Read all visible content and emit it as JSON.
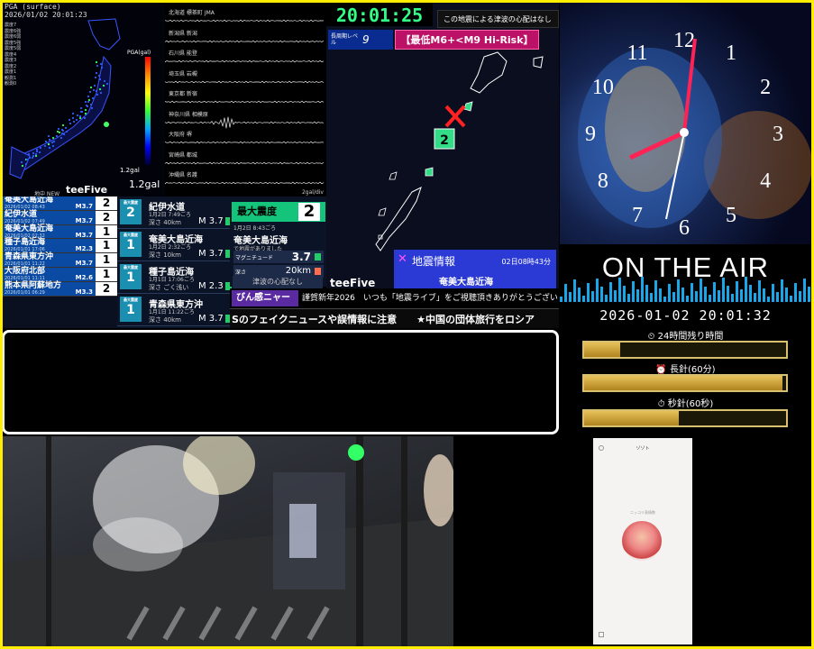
{
  "left_map": {
    "header_line1": "PGA (surface)",
    "header_line2": "2026/01/02 20:01:23",
    "legend_lines": [
      "震度7",
      "震度6強",
      "震度6弱",
      "震度5強",
      "震度5弱",
      "震度4",
      "震度3",
      "震度2",
      "震度1",
      "観測1",
      "観測0"
    ],
    "pga_label": "PGA(gal)",
    "scale_value": "1.2gal",
    "scale_small": "1.2gal",
    "footer_left": "地中 NEW",
    "brand": "teeFive"
  },
  "seismo": {
    "stations": [
      "北海道 標茶町 JMA",
      "新潟県 新潟",
      "石川県 能登",
      "埼玉県 岩槻",
      "東京都 新宿",
      "神奈川県 相模原",
      "大阪府 堺",
      "宮崎県 都城",
      "沖縄県 名護"
    ],
    "footer": "2gal/div"
  },
  "intensity_list": [
    {
      "name": "奄美大島近海",
      "date": "2026/01/02 08:43",
      "mag": "M3.7",
      "val": "2"
    },
    {
      "name": "紀伊水道",
      "date": "2026/01/02 07:49",
      "mag": "M3.7",
      "val": "2"
    },
    {
      "name": "奄美大島近海",
      "date": "2026/01/02 02:32",
      "mag": "M3.7",
      "val": "1"
    },
    {
      "name": "種子島近海",
      "date": "2026/01/01 17:06",
      "mag": "M2.3",
      "val": "1"
    },
    {
      "name": "青森県東方沖",
      "date": "2026/01/01 11:22",
      "mag": "M3.7",
      "val": "1"
    },
    {
      "name": "大阪府北部",
      "date": "2026/01/01 11:11",
      "mag": "M2.6",
      "val": "1"
    },
    {
      "name": "熊本県阿蘇地方",
      "date": "2026/01/01 06:29",
      "mag": "M3.3",
      "val": "2"
    }
  ],
  "quake_list": [
    {
      "badge_label": "最大震度",
      "val": "2",
      "name": "紀伊水道",
      "date": "1月2日 7:49ごろ",
      "depth": "深さ 40km",
      "mag": "M 3.7"
    },
    {
      "badge_label": "最大震度",
      "val": "1",
      "name": "奄美大島近海",
      "date": "1月2日 2:32ごろ",
      "depth": "深さ 10km",
      "mag": "M 3.7"
    },
    {
      "badge_label": "最大震度",
      "val": "1",
      "name": "種子島近海",
      "date": "1月1日 17:06ごろ",
      "depth": "深さ ごく浅い",
      "mag": "M 2.3"
    },
    {
      "badge_label": "最大震度",
      "val": "1",
      "name": "青森県東方沖",
      "date": "1月1日 11:22ごろ",
      "depth": "深さ 40km",
      "mag": "M 3.7"
    }
  ],
  "max_intensity": {
    "label": "最大震度",
    "value": "2",
    "time": "1月2日 8:43ごろ",
    "region": "奄美大島近海",
    "region_note": "で地震がありました",
    "mag_label": "マグニチュード",
    "mag_value": "3.7",
    "depth_label": "深さ",
    "depth_value": "20km",
    "tsunami": "津波の心配なし"
  },
  "center": {
    "digital_clock": "20:01:25",
    "tsunami_notice": "この地震による津波の心配はなし",
    "level_label": "長周期レベル",
    "level_value": "9",
    "risk": "【最低M6+<M9 Hi-Risk】",
    "info_title": "地震情報",
    "info_date": "02日08時43分",
    "info_place": "奄美大島近海",
    "epicenter_intensity": "2",
    "brand": "teeFive"
  },
  "clock_face": {
    "numerals": [
      "12",
      "1",
      "2",
      "3",
      "4",
      "5",
      "6",
      "7",
      "8",
      "9",
      "10",
      "11"
    ]
  },
  "onair": {
    "title": "ON THE AIR",
    "datetime": "2026-01-02 20:01:32",
    "bars": [
      {
        "label": "⏲ 24時間残り時間",
        "value": 0.18
      },
      {
        "label": "⏰ 長針(60分)",
        "value": 0.98
      },
      {
        "label": "⏱ 秒針(60秒)",
        "value": 0.47
      }
    ]
  },
  "ticker": {
    "tag": "びん感ニャース",
    "line1": "謹賀新年2026　いつも「地震ライブ」をご視聴頂きありがとうございます!",
    "line2": "Sのフェイクニュースや誤情報に注意　　★中国の団体旅行をロシア"
  },
  "phone": {
    "title": "ゾゾト",
    "caption": "ニッコリ表情数"
  },
  "colors": {
    "frame": "#ffee00",
    "accent_green": "#14c47a",
    "list_blue": "#0a4aa2",
    "risk_magenta": "#bb1166",
    "quake_info_blue": "#2b3ad4"
  }
}
